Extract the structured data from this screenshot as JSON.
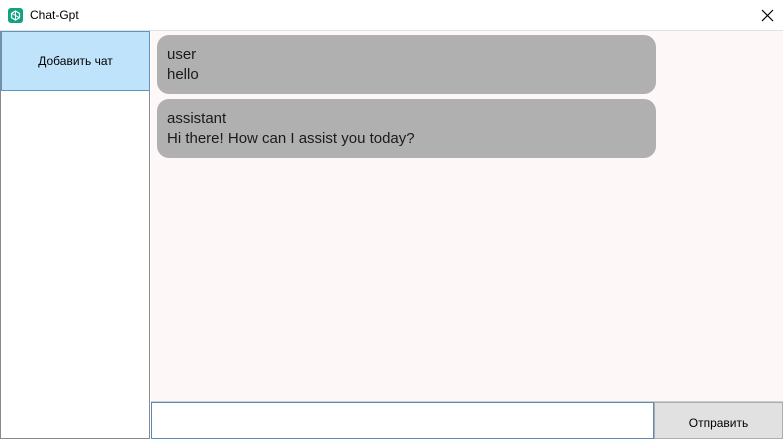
{
  "window": {
    "title": "Chat-Gpt",
    "icon": "chatgpt-logo-icon",
    "close_icon": "close-icon"
  },
  "sidebar": {
    "add_chat_label": "Добавить чат"
  },
  "messages": [
    {
      "role": "user",
      "text": "hello"
    },
    {
      "role": "assistant",
      "text": "Hi there! How can I assist you today?"
    }
  ],
  "composer": {
    "input_value": "",
    "input_placeholder": "",
    "send_label": "Отправить"
  },
  "colors": {
    "accent": "#bfe3fa",
    "bubble": "#b0b0b0",
    "chat_background": "#fdf8f7",
    "app_icon": "#10a37f"
  }
}
